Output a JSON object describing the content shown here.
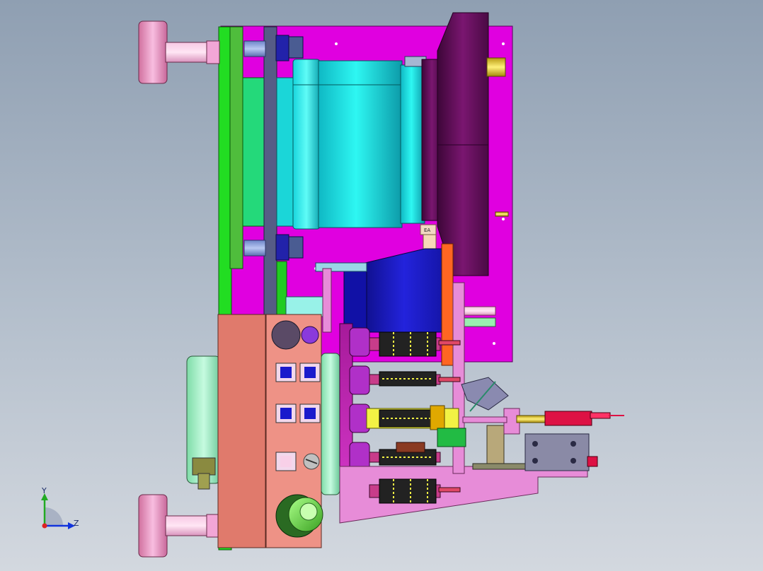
{
  "viewport": {
    "background_top": "#8f9fb2",
    "background_bottom": "#d3d8df"
  },
  "triad": {
    "y_label": "Y",
    "z_label": "Z",
    "y_color": "#22aa22",
    "z_color": "#1133dd",
    "origin_color": "#dd2222"
  },
  "part_tag": {
    "text": "EA"
  },
  "colors": {
    "plate_magenta": "#e000e0",
    "plate_green": "#22dd22",
    "cylinder_cyan": "#19e6e6",
    "disc_purple": "#6a0f60",
    "block_blue": "#1a1acc",
    "block_salmon": "#e07a6c",
    "support_pink": "#e78cd8",
    "foot_pink": "#f2a6d6",
    "cylinder_mint": "#a6f2c8",
    "knob_green": "#66dd44",
    "accent_yellow": "#f2f244",
    "accent_red": "#dd1144",
    "accent_orange": "#ff6622"
  }
}
